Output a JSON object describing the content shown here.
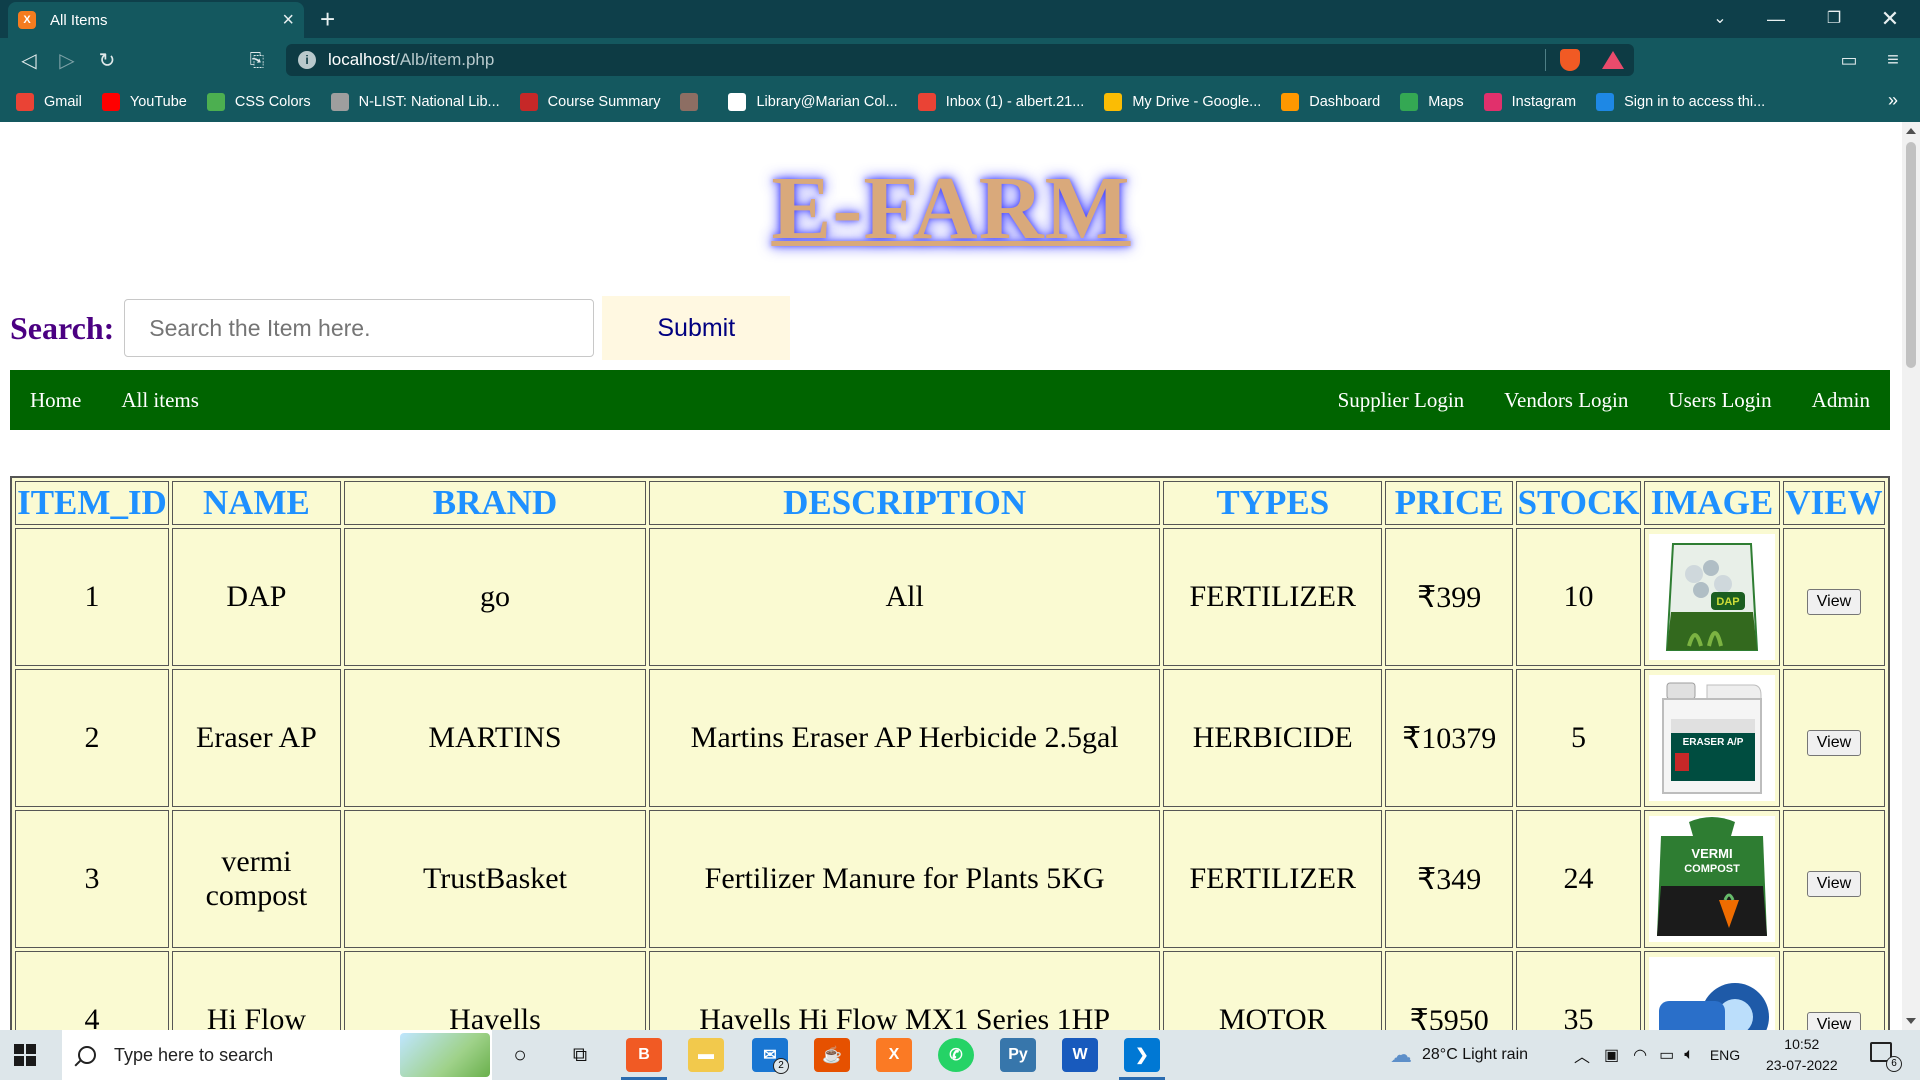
{
  "browser": {
    "tab_title": "All Items",
    "tab_favicon_text": "X",
    "url_host": "localhost",
    "url_path": "/Alb/item.php",
    "bookmarks": [
      {
        "label": "Gmail",
        "icon": "gmail-icon",
        "color": "#ea4335"
      },
      {
        "label": "YouTube",
        "icon": "youtube-icon",
        "color": "#ff0000"
      },
      {
        "label": "CSS Colors",
        "icon": "css-colors-icon",
        "color": "#4caf50"
      },
      {
        "label": "N-LIST: National Lib...",
        "icon": "nlist-icon",
        "color": "#9e9e9e"
      },
      {
        "label": "Course Summary",
        "icon": "course-icon",
        "color": "#c62828"
      },
      {
        "label": "",
        "icon": "college-icon",
        "color": "#8d6e63"
      },
      {
        "label": "Library@Marian Col...",
        "icon": "koha-icon",
        "color": "#ffffff"
      },
      {
        "label": "Inbox (1) - albert.21...",
        "icon": "gmail-icon",
        "color": "#ea4335"
      },
      {
        "label": "My Drive - Google...",
        "icon": "google-drive-icon",
        "color": "#fbbc04"
      },
      {
        "label": "Dashboard",
        "icon": "dashboard-icon",
        "color": "#ff9800"
      },
      {
        "label": "Maps",
        "icon": "maps-icon",
        "color": "#34a853"
      },
      {
        "label": "Instagram",
        "icon": "instagram-icon",
        "color": "#e1306c"
      },
      {
        "label": "Sign in to access thi...",
        "icon": "sign-in-icon",
        "color": "#1e88e5"
      }
    ]
  },
  "page": {
    "logo": "E-FARM",
    "search_label": "Search:",
    "search_placeholder": "Search the Item here.",
    "submit_label": "Submit",
    "nav_left": [
      "Home",
      "All items"
    ],
    "nav_right": [
      "Supplier Login",
      "Vendors Login",
      "Users Login",
      "Admin"
    ],
    "table": {
      "headers": [
        "ITEM_ID",
        "NAME",
        "BRAND",
        "DESCRIPTION",
        "TYPES",
        "PRICE",
        "STOCK",
        "IMAGE",
        "VIEW"
      ],
      "rows": [
        {
          "id": "1",
          "name": "DAP",
          "brand": "go",
          "description": "All",
          "type": "FERTILIZER",
          "price": "₹399",
          "stock": "10",
          "image": "dap-fertilizer-bag",
          "view": "View"
        },
        {
          "id": "2",
          "name": "Eraser AP",
          "brand": "MARTINS",
          "description": "Martins Eraser AP Herbicide 2.5gal",
          "type": "HERBICIDE",
          "price": "₹10379",
          "stock": "5",
          "image": "eraser-ap-herbicide-jug",
          "view": "View"
        },
        {
          "id": "3",
          "name": "vermi compost",
          "brand": "TrustBasket",
          "description": "Fertilizer Manure for Plants 5KG",
          "type": "FERTILIZER",
          "price": "₹349",
          "stock": "24",
          "image": "vermi-compost-bag",
          "view": "View"
        },
        {
          "id": "4",
          "name": "Hi Flow",
          "brand": "Havells",
          "description": "Havells Hi Flow MX1 Series 1HP",
          "type": "MOTOR",
          "price": "₹5950",
          "stock": "35",
          "image": "havells-pump-motor",
          "view": "View"
        }
      ]
    }
  },
  "taskbar": {
    "search_placeholder": "Type here to search",
    "mail_badge": "2",
    "weather": "28°C  Light rain",
    "language": "ENG",
    "time": "10:52",
    "date": "23-07-2022",
    "notification_count": "6"
  }
}
